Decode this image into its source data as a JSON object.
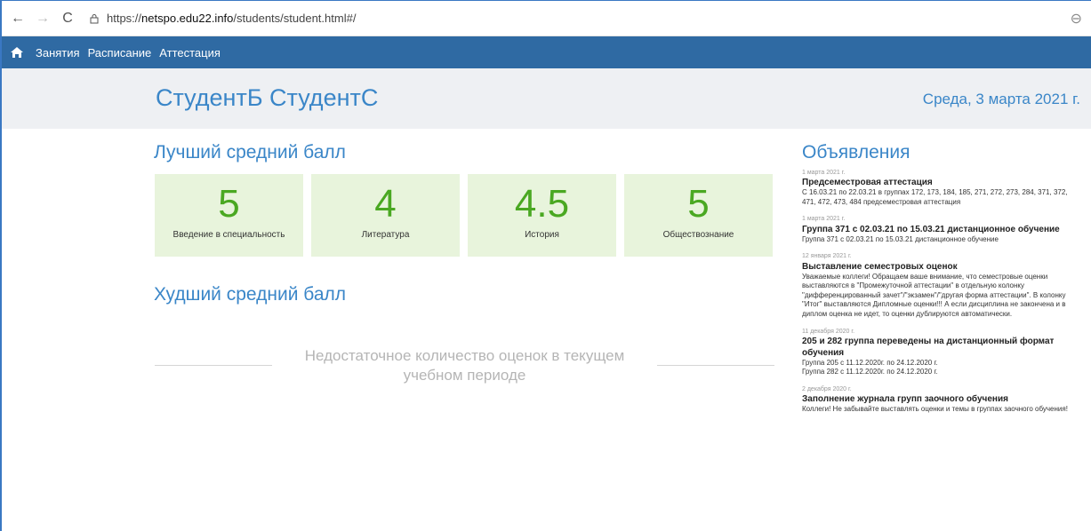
{
  "browser": {
    "back": "←",
    "forward": "→",
    "reload": "C",
    "url_prefix": "https://",
    "url_domain": "netspo.edu22.info",
    "url_path": "/students/student.html#/",
    "zoom": "⊖"
  },
  "nav": {
    "items": [
      {
        "label": "Занятия"
      },
      {
        "label": "Расписание"
      },
      {
        "label": "Аттестация"
      }
    ]
  },
  "header": {
    "student_name": "СтудентБ СтудентС",
    "date": "Среда, 3 марта 2021 г."
  },
  "best": {
    "title": "Лучший средний балл",
    "cards": [
      {
        "value": "5",
        "subject": "Введение в специальность"
      },
      {
        "value": "4",
        "subject": "Литература"
      },
      {
        "value": "4.5",
        "subject": "История"
      },
      {
        "value": "5",
        "subject": "Обществознание"
      }
    ]
  },
  "worst": {
    "title": "Худший средний балл",
    "message": "Недостаточное количество оценок в текущем учебном периоде"
  },
  "announcements": {
    "title": "Объявления",
    "items": [
      {
        "date": "1 марта 2021 г.",
        "title": "Предсеместровая аттестация",
        "body": "С 16.03.21 по 22.03.21 в группах 172, 173, 184, 185, 271, 272, 273, 284, 371, 372, 471, 472, 473, 484 предсеместровая аттестация"
      },
      {
        "date": "1 марта 2021 г.",
        "title": "Группа 371 с 02.03.21 по 15.03.21 дистанционное обучение",
        "body": "Группа 371 с 02.03.21 по 15.03.21 дистанционное обучение"
      },
      {
        "date": "12 января 2021 г.",
        "title": "Выставление семестровых оценок",
        "body": "Уважаемые коллеги! Обращаем ваше внимание, что семестровые оценки выставляются в \"Промежуточной аттестации\" в отдельную колонку \"дифференцированный зачет\"/\"экзамен\"/\"другая форма аттестации\". В колонку \"Итог\" выставляются Дипломные оценки!!! А если дисциплина не закончена и в диплом оценка не идет, то оценки дублируются автоматически."
      },
      {
        "date": "11 декабря 2020 г.",
        "title": "205 и 282 группа переведены на дистанционный формат обучения",
        "body": "Группа 205 с 11.12.2020г. по 24.12.2020 г.",
        "body2": "Группа 282 с 11.12.2020г. по 24.12.2020 г."
      },
      {
        "date": "2 декабря 2020 г.",
        "title": "Заполнение журнала групп заочного обучения",
        "body": "Коллеги! Не забывайте выставлять оценки и темы в группах заочного обучения!"
      }
    ]
  },
  "colors": {
    "nav_bg": "#2f6aa3",
    "accent_blue": "#3a86c8",
    "card_bg": "#e8f4dc",
    "grade_green": "#4aa822"
  }
}
